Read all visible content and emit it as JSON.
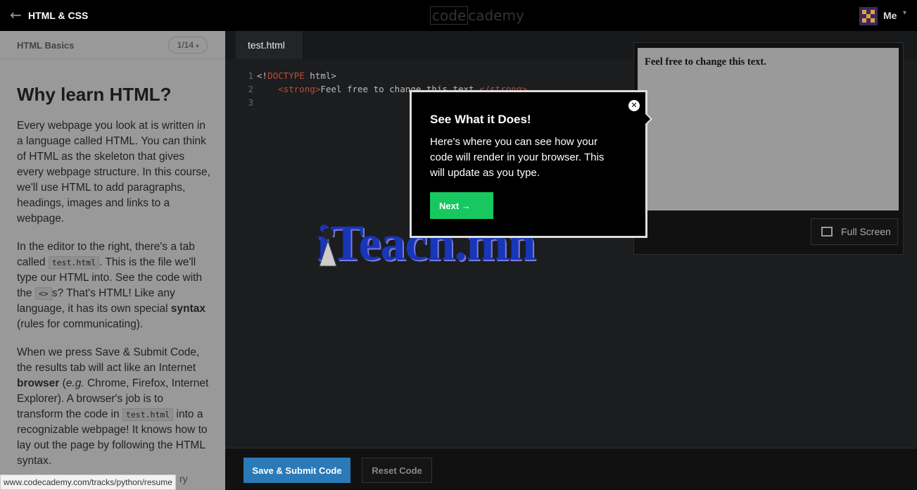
{
  "topbar": {
    "back_icon": "arrow-left-icon",
    "course_title": "HTML & CSS",
    "logo_left": "code",
    "logo_right": "cademy",
    "user_label": "Me"
  },
  "lesson": {
    "unit_name": "HTML Basics",
    "pager": "1/14",
    "title": "Why learn HTML?",
    "p1": "Every webpage you look at is written in a language called HTML. You can think of HTML as the skeleton that gives every webpage structure. In this course, we'll use HTML to add paragraphs, headings, images and links to a webpage.",
    "p2_a": "In the editor to the right, there's a tab called",
    "p2_code1": "test.html",
    "p2_b": ". This is the file we'll type our HTML into. See the code with the",
    "p2_code2": "<>",
    "p2_c": "s? That's HTML! Like any language, it has its own special",
    "p2_bold": "syntax",
    "p2_d": "(rules for communicating).",
    "p3_a": "When we press Save & Submit Code, the results tab will act like an Internet",
    "p3_bold": "browser",
    "p3_b": "(",
    "p3_em": "e.g.",
    "p3_c": "Chrome, Firefox, Internet Explorer). A browser's job is to transform the code in",
    "p3_code": "test.html",
    "p3_d": "into a recognizable webpage! It knows how to lay out the page by following the HTML syntax."
  },
  "status_url": "www.codecademy.com/tracks/python/resume",
  "status_tail": "ry",
  "editor": {
    "tab": "test.html",
    "line_numbers": [
      "1",
      "2",
      "3"
    ],
    "line1_a": "<!",
    "line1_kw": "DOCTYPE",
    "line1_b": " html>",
    "line2_indent": "    ",
    "line2_tag": "<strong>",
    "line2_text": "Feel free to change this text.",
    "line2_close": "</strong>"
  },
  "preview": {
    "text": "Feel free to change this text.",
    "fullscreen_label": "Full Screen"
  },
  "popup": {
    "title": "See What it Does!",
    "body": "Here's where you can see how your code will render in your browser. This will update as you type.",
    "next_label": "Next →",
    "close_glyph": "✕"
  },
  "bottom": {
    "save_label": "Save & Submit Code",
    "reset_label": "Reset Code"
  },
  "watermark": "iTeach.mn",
  "colors": {
    "save": "#2a7ab8",
    "next": "#17c861",
    "watermark": "#1736b8"
  }
}
